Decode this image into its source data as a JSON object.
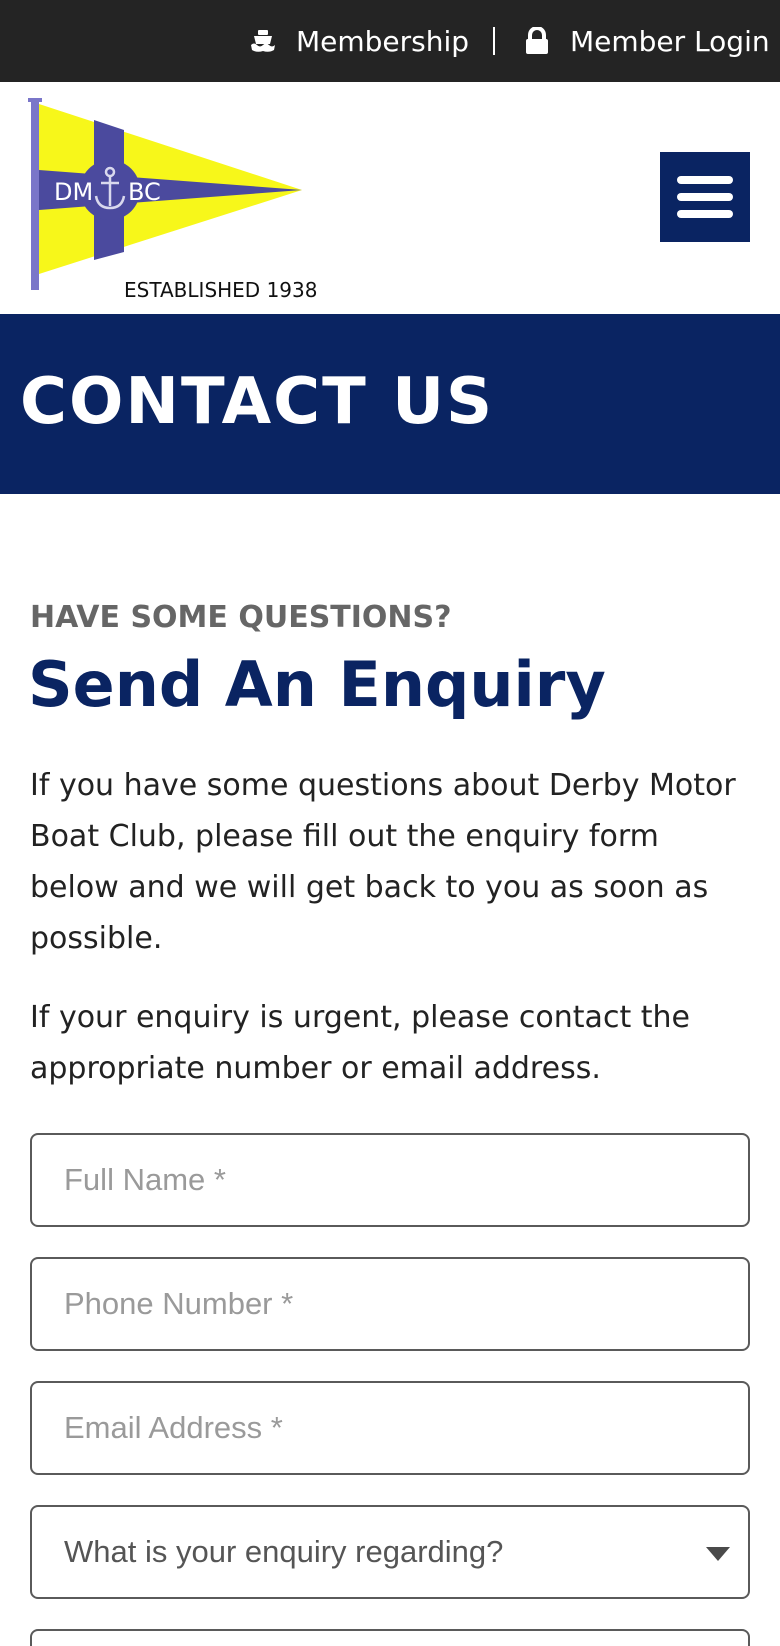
{
  "topbar": {
    "membership_label": "Membership",
    "member_login_label": "Member Login",
    "membership_icon": "boat-icon",
    "login_icon": "lock-icon"
  },
  "logo": {
    "flag_text_left": "DM",
    "flag_text_right": "BC",
    "caption": "ESTABLISHED 1938",
    "colors": {
      "flag_yellow": "#f7f71a",
      "flag_purple": "#4b4a9e",
      "pole": "#7a76c9"
    }
  },
  "header": {
    "menu_icon": "hamburger-menu-icon"
  },
  "banner": {
    "title": "CONTACT US"
  },
  "main": {
    "eyebrow": "HAVE SOME QUESTIONS?",
    "heading": "Send An Enquiry",
    "paragraph_1": "If you have some questions about Derby Motor Boat Club, please fill out the enquiry form below and we will get back to you as soon as possible.",
    "paragraph_2": "If your enquiry is urgent, please contact the appropriate number or email address."
  },
  "form": {
    "full_name_placeholder": "Full Name *",
    "phone_placeholder": "Phone Number *",
    "email_placeholder": "Email Address *",
    "enquiry_select_value": "What is your enquiry regarding?"
  },
  "colors": {
    "brand_navy": "#0a2462",
    "topbar_bg": "#242424",
    "eyebrow_gray": "#666666"
  }
}
